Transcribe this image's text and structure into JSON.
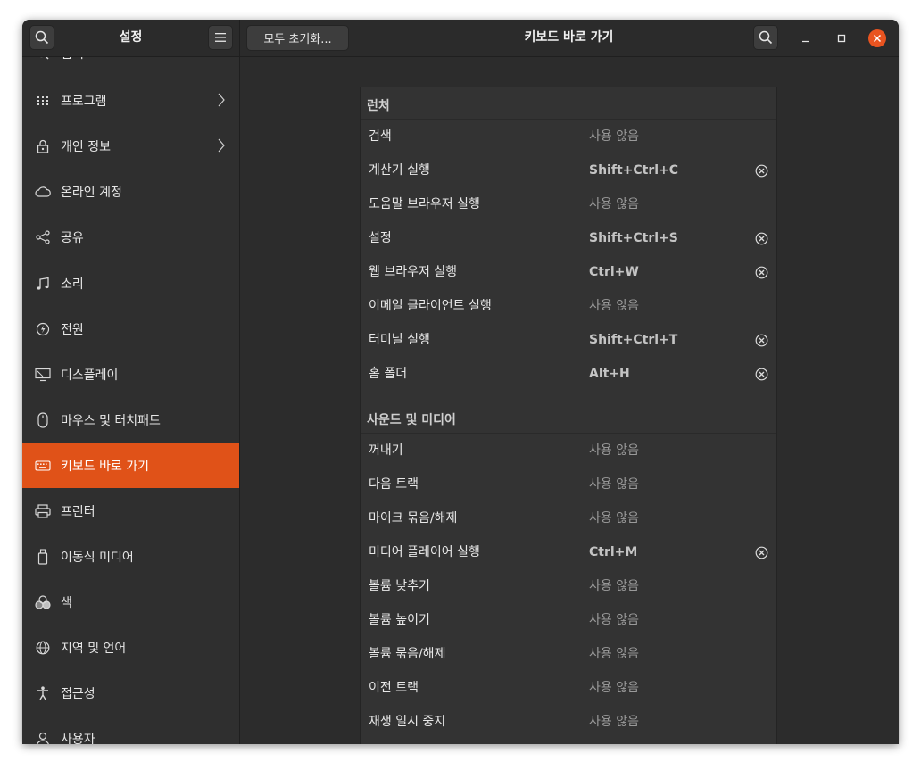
{
  "titlebar": {
    "sidebar_title": "설정",
    "reset_button": "모두 초기화...",
    "title": "키보드 바로 가기"
  },
  "sidebar": {
    "items": [
      {
        "label": "검색",
        "icon": "search-icon"
      },
      {
        "label": "프로그램",
        "icon": "apps-grid-icon",
        "chevron": true
      },
      {
        "label": "개인 정보",
        "icon": "lock-icon",
        "chevron": true
      },
      {
        "label": "온라인 계정",
        "icon": "cloud-icon"
      },
      {
        "label": "공유",
        "icon": "share-icon"
      },
      {
        "label": "소리",
        "icon": "music-note-icon"
      },
      {
        "label": "전원",
        "icon": "power-icon"
      },
      {
        "label": "디스플레이",
        "icon": "display-icon"
      },
      {
        "label": "마우스 및 터치패드",
        "icon": "mouse-icon"
      },
      {
        "label": "키보드 바로 가기",
        "icon": "keyboard-icon",
        "active": true
      },
      {
        "label": "프린터",
        "icon": "printer-icon"
      },
      {
        "label": "이동식 미디어",
        "icon": "removable-media-icon"
      },
      {
        "label": "색",
        "icon": "color-icon"
      },
      {
        "label": "지역 및 언어",
        "icon": "globe-icon"
      },
      {
        "label": "접근성",
        "icon": "accessibility-icon"
      },
      {
        "label": "사용자",
        "icon": "user-icon"
      }
    ]
  },
  "sections": [
    {
      "title": "런처",
      "rows": [
        {
          "name": "검색",
          "accel": "사용 않음",
          "set": false
        },
        {
          "name": "계산기 실행",
          "accel": "Shift+Ctrl+C",
          "set": true
        },
        {
          "name": "도움말 브라우저 실행",
          "accel": "사용 않음",
          "set": false
        },
        {
          "name": "설정",
          "accel": "Shift+Ctrl+S",
          "set": true
        },
        {
          "name": "웹 브라우저 실행",
          "accel": "Ctrl+W",
          "set": true
        },
        {
          "name": "이메일 클라이언트 실행",
          "accel": "사용 않음",
          "set": false
        },
        {
          "name": "터미널 실행",
          "accel": "Shift+Ctrl+T",
          "set": true
        },
        {
          "name": "홈 폴더",
          "accel": "Alt+H",
          "set": true
        }
      ]
    },
    {
      "title": "사운드 및 미디어",
      "rows": [
        {
          "name": "꺼내기",
          "accel": "사용 않음",
          "set": false
        },
        {
          "name": "다음 트랙",
          "accel": "사용 않음",
          "set": false
        },
        {
          "name": "마이크 묶음/해제",
          "accel": "사용 않음",
          "set": false
        },
        {
          "name": "미디어 플레이어 실행",
          "accel": "Ctrl+M",
          "set": true
        },
        {
          "name": "볼륨 낮추기",
          "accel": "사용 않음",
          "set": false
        },
        {
          "name": "볼륨 높이기",
          "accel": "사용 않음",
          "set": false
        },
        {
          "name": "볼륨 묶음/해제",
          "accel": "사용 않음",
          "set": false
        },
        {
          "name": "이전 트랙",
          "accel": "사용 않음",
          "set": false
        },
        {
          "name": "재생 일시 중지",
          "accel": "사용 않음",
          "set": false
        }
      ]
    }
  ],
  "colors": {
    "accent": "#e05218",
    "close_button": "#e95420"
  }
}
